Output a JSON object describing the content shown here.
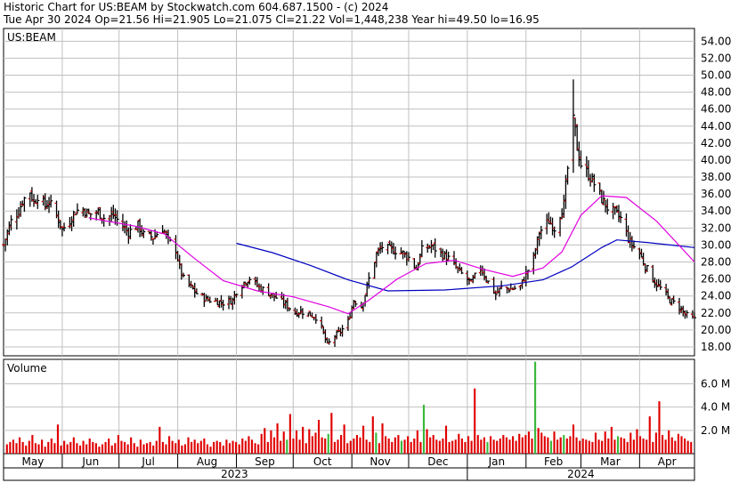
{
  "header": {
    "title_line": "Historic Chart for US:BEAM by Stockwatch.com 604.687.1500 - (c) 2024",
    "quote_line": "Tue Apr 30 2024   Op=21.56   Hi=21.905   Lo=21.075   Cl=21.22   Vol=1,448,238   Year hi=49.50   lo=16.95"
  },
  "chart_data": [
    {
      "type": "candlestick",
      "symbol_label": "US:BEAM",
      "x_range": [
        "2023-05-01",
        "2024-04-30"
      ],
      "ylim": [
        16.95,
        55.5
      ],
      "y_ticks": [
        "18.00",
        "20.00",
        "22.00",
        "24.00",
        "26.00",
        "28.00",
        "30.00",
        "32.00",
        "34.00",
        "36.00",
        "38.00",
        "40.00",
        "42.00",
        "44.00",
        "46.00",
        "48.00",
        "50.00",
        "52.00",
        "54.00"
      ],
      "x_month_labels": [
        {
          "date": "2023-05-01",
          "label": "May"
        },
        {
          "date": "2023-06-01",
          "label": "Jun"
        },
        {
          "date": "2023-07-01",
          "label": "Jul"
        },
        {
          "date": "2023-08-01",
          "label": "Aug"
        },
        {
          "date": "2023-09-01",
          "label": "Sep"
        },
        {
          "date": "2023-10-01",
          "label": "Oct"
        },
        {
          "date": "2023-11-01",
          "label": "Nov"
        },
        {
          "date": "2023-12-01",
          "label": "Dec"
        },
        {
          "date": "2024-01-01",
          "label": "Jan"
        },
        {
          "date": "2024-02-01",
          "label": "Feb"
        },
        {
          "date": "2024-03-01",
          "label": "Mar"
        },
        {
          "date": "2024-04-01",
          "label": "Apr"
        }
      ],
      "x_year_labels": [
        {
          "from": "2023-05-01",
          "to": "2023-12-31",
          "label": "2023"
        },
        {
          "from": "2024-01-01",
          "to": "2024-04-30",
          "label": "2024"
        }
      ],
      "grid": true,
      "colors": {
        "bar": "#000000",
        "open_tick": "#cc0000",
        "ma_short": "#e000e0",
        "ma_long": "#0000c0",
        "grid": "#c0c0c0"
      },
      "price_points": [
        [
          "2023-05-01",
          30.0
        ],
        [
          "2023-05-03",
          31.5
        ],
        [
          "2023-05-05",
          32.8
        ],
        [
          "2023-05-09",
          34.0
        ],
        [
          "2023-05-11",
          35.2
        ],
        [
          "2023-05-15",
          36.3
        ],
        [
          "2023-05-17",
          35.0
        ],
        [
          "2023-05-19",
          35.8
        ],
        [
          "2023-05-23",
          34.6
        ],
        [
          "2023-05-25",
          35.1
        ],
        [
          "2023-05-30",
          33.0
        ],
        [
          "2023-06-01",
          31.8
        ],
        [
          "2023-06-05",
          32.9
        ],
        [
          "2023-06-08",
          34.0
        ],
        [
          "2023-06-12",
          34.2
        ],
        [
          "2023-06-15",
          33.6
        ],
        [
          "2023-06-20",
          33.9
        ],
        [
          "2023-06-23",
          33.2
        ],
        [
          "2023-06-28",
          33.5
        ],
        [
          "2023-07-03",
          32.2
        ],
        [
          "2023-07-06",
          31.5
        ],
        [
          "2023-07-11",
          32.3
        ],
        [
          "2023-07-14",
          31.2
        ],
        [
          "2023-07-19",
          30.9
        ],
        [
          "2023-07-24",
          32.0
        ],
        [
          "2023-07-27",
          30.5
        ],
        [
          "2023-07-31",
          29.5
        ],
        [
          "2023-08-02",
          27.3
        ],
        [
          "2023-08-04",
          26.0
        ],
        [
          "2023-08-08",
          25.0
        ],
        [
          "2023-08-11",
          24.3
        ],
        [
          "2023-08-16",
          23.6
        ],
        [
          "2023-08-21",
          23.4
        ],
        [
          "2023-08-25",
          23.2
        ],
        [
          "2023-08-30",
          23.5
        ],
        [
          "2023-09-01",
          24.6
        ],
        [
          "2023-09-05",
          25.6
        ],
        [
          "2023-09-08",
          26.1
        ],
        [
          "2023-09-13",
          25.0
        ],
        [
          "2023-09-18",
          24.4
        ],
        [
          "2023-09-22",
          23.8
        ],
        [
          "2023-09-27",
          23.0
        ],
        [
          "2023-10-02",
          22.0
        ],
        [
          "2023-10-05",
          22.2
        ],
        [
          "2023-10-10",
          21.8
        ],
        [
          "2023-10-13",
          21.5
        ],
        [
          "2023-10-16",
          20.2
        ],
        [
          "2023-10-19",
          18.2
        ],
        [
          "2023-10-23",
          19.3
        ],
        [
          "2023-10-26",
          19.8
        ],
        [
          "2023-10-30",
          21.0
        ],
        [
          "2023-11-02",
          23.5
        ],
        [
          "2023-11-06",
          22.8
        ],
        [
          "2023-11-08",
          24.2
        ],
        [
          "2023-11-10",
          26.0
        ],
        [
          "2023-11-14",
          28.9
        ],
        [
          "2023-11-17",
          29.8
        ],
        [
          "2023-11-21",
          29.5
        ],
        [
          "2023-11-27",
          29.2
        ],
        [
          "2023-12-01",
          28.5
        ],
        [
          "2023-12-05",
          27.2
        ],
        [
          "2023-12-08",
          29.4
        ],
        [
          "2023-12-13",
          29.9
        ],
        [
          "2023-12-18",
          29.0
        ],
        [
          "2023-12-22",
          28.4
        ],
        [
          "2023-12-28",
          26.8
        ],
        [
          "2024-01-03",
          25.5
        ],
        [
          "2024-01-08",
          27.4
        ],
        [
          "2024-01-11",
          26.0
        ],
        [
          "2024-01-16",
          24.2
        ],
        [
          "2024-01-19",
          25.0
        ],
        [
          "2024-01-24",
          24.8
        ],
        [
          "2024-01-29",
          25.1
        ],
        [
          "2024-02-01",
          26.6
        ],
        [
          "2024-02-05",
          28.5
        ],
        [
          "2024-02-08",
          31.5
        ],
        [
          "2024-02-13",
          32.8
        ],
        [
          "2024-02-16",
          32.0
        ],
        [
          "2024-02-21",
          34.8
        ],
        [
          "2024-02-26",
          45.3
        ],
        [
          "2024-02-28",
          41.5
        ],
        [
          "2024-03-01",
          39.5
        ],
        [
          "2024-03-05",
          38.3
        ],
        [
          "2024-03-08",
          37.2
        ],
        [
          "2024-03-12",
          35.4
        ],
        [
          "2024-03-15",
          34.4
        ],
        [
          "2024-03-19",
          33.8
        ],
        [
          "2024-03-22",
          33.1
        ],
        [
          "2024-03-27",
          30.3
        ],
        [
          "2024-04-01",
          29.0
        ],
        [
          "2024-04-04",
          27.5
        ],
        [
          "2024-04-09",
          25.6
        ],
        [
          "2024-04-12",
          24.9
        ],
        [
          "2024-04-17",
          23.5
        ],
        [
          "2024-04-22",
          22.7
        ],
        [
          "2024-04-25",
          21.8
        ],
        [
          "2024-04-30",
          21.22
        ]
      ],
      "ma_short_points": [
        [
          "2023-06-15",
          33.2
        ],
        [
          "2023-07-10",
          32.2
        ],
        [
          "2023-07-25",
          31.3
        ],
        [
          "2023-08-10",
          28.4
        ],
        [
          "2023-08-25",
          25.8
        ],
        [
          "2023-09-12",
          24.6
        ],
        [
          "2023-10-01",
          23.9
        ],
        [
          "2023-10-20",
          22.7
        ],
        [
          "2023-10-30",
          21.9
        ],
        [
          "2023-11-10",
          23.5
        ],
        [
          "2023-11-25",
          26.0
        ],
        [
          "2023-12-10",
          27.8
        ],
        [
          "2023-12-25",
          28.2
        ],
        [
          "2024-01-10",
          27.1
        ],
        [
          "2024-01-25",
          26.3
        ],
        [
          "2024-02-10",
          27.3
        ],
        [
          "2024-02-20",
          29.2
        ],
        [
          "2024-03-01",
          33.5
        ],
        [
          "2024-03-12",
          35.8
        ],
        [
          "2024-03-25",
          35.6
        ],
        [
          "2024-04-10",
          32.8
        ],
        [
          "2024-04-30",
          28.0
        ]
      ],
      "ma_long_points": [
        [
          "2023-09-01",
          30.2
        ],
        [
          "2023-09-20",
          29.1
        ],
        [
          "2023-10-10",
          27.6
        ],
        [
          "2023-10-30",
          25.9
        ],
        [
          "2023-11-20",
          24.6
        ],
        [
          "2023-12-20",
          24.7
        ],
        [
          "2024-01-20",
          25.2
        ],
        [
          "2024-02-10",
          25.9
        ],
        [
          "2024-02-25",
          27.4
        ],
        [
          "2024-03-12",
          29.7
        ],
        [
          "2024-03-20",
          30.6
        ],
        [
          "2024-04-05",
          30.3
        ],
        [
          "2024-04-30",
          29.7
        ]
      ],
      "peak_spike": {
        "date": "2024-02-26",
        "high": 49.5,
        "low": 38.5
      }
    },
    {
      "type": "bar",
      "label": "Volume",
      "ylim": [
        0,
        8100000
      ],
      "y_ticks": [
        "2.0 M",
        "4.0 M",
        "6.0 M"
      ],
      "colors": {
        "bar": "#e00000",
        "tall_bar": "#3ab83a"
      },
      "values_millions": [
        0.8,
        1.0,
        1.2,
        0.9,
        1.4,
        1.0,
        0.7,
        1.1,
        1.6,
        0.9,
        0.8,
        1.2,
        0.6,
        1.0,
        1.3,
        0.9,
        2.5,
        0.7,
        1.1,
        0.8,
        1.0,
        1.4,
        0.9,
        0.7,
        1.1,
        0.8,
        1.3,
        1.0,
        0.9,
        0.6,
        0.8,
        1.0,
        1.3,
        0.7,
        0.9,
        1.6,
        1.1,
        1.0,
        0.8,
        1.4,
        0.9,
        0.6,
        1.2,
        0.8,
        0.9,
        1.0,
        0.7,
        1.1,
        2.3,
        1.0,
        0.8,
        1.5,
        1.1,
        0.9,
        1.2,
        0.7,
        0.8,
        1.4,
        1.0,
        1.2,
        0.9,
        1.1,
        1.3,
        0.8,
        0.6,
        1.0,
        1.1,
        1.0,
        0.7,
        1.2,
        0.9,
        1.1,
        1.0,
        0.8,
        1.3,
        1.1,
        1.5,
        1.2,
        0.9,
        0.8,
        1.7,
        2.2,
        1.0,
        2.0,
        1.4,
        2.6,
        1.1,
        1.9,
        1.2,
        3.4,
        1.3,
        2.0,
        1.2,
        2.3,
        0.9,
        2.1,
        1.5,
        1.8,
        2.9,
        1.4,
        1.3,
        1.7,
        3.5,
        1.0,
        1.2,
        1.6,
        2.5,
        0.9,
        1.1,
        1.3,
        1.6,
        1.4,
        2.4,
        1.2,
        1.0,
        3.2,
        1.8,
        0.9,
        2.6,
        1.5,
        1.3,
        1.0,
        1.4,
        1.6,
        1.1,
        1.2,
        1.5,
        1.0,
        1.3,
        2.0,
        1.0,
        4.2,
        2.1,
        1.4,
        1.6,
        1.2,
        1.1,
        1.3,
        2.4,
        1.0,
        1.1,
        1.2,
        1.7,
        1.3,
        1.0,
        1.5,
        1.1,
        5.6,
        1.6,
        1.2,
        1.4,
        1.0,
        1.5,
        1.2,
        1.1,
        1.3,
        1.6,
        1.4,
        1.2,
        1.5,
        1.1,
        1.7,
        1.4,
        1.6,
        1.9,
        1.3,
        7.9,
        2.2,
        1.8,
        1.5,
        1.4,
        1.1,
        1.9,
        1.2,
        1.4,
        1.6,
        1.3,
        1.5,
        2.5,
        1.4,
        1.1,
        1.3,
        1.2,
        1.1,
        1.0,
        1.8,
        1.2,
        1.1,
        1.9,
        1.3,
        2.3,
        1.2,
        1.5,
        1.4,
        1.3,
        1.0,
        1.8,
        1.2,
        2.1,
        1.5,
        1.3,
        1.2,
        3.2,
        1.0,
        1.8,
        4.5,
        1.6,
        1.2,
        2.0,
        1.4,
        1.1,
        1.7,
        1.5,
        1.3,
        1.1,
        1.0
      ],
      "tall_green_indices": [
        88,
        101,
        116,
        124,
        131,
        151,
        166,
        171,
        175,
        192
      ]
    }
  ]
}
